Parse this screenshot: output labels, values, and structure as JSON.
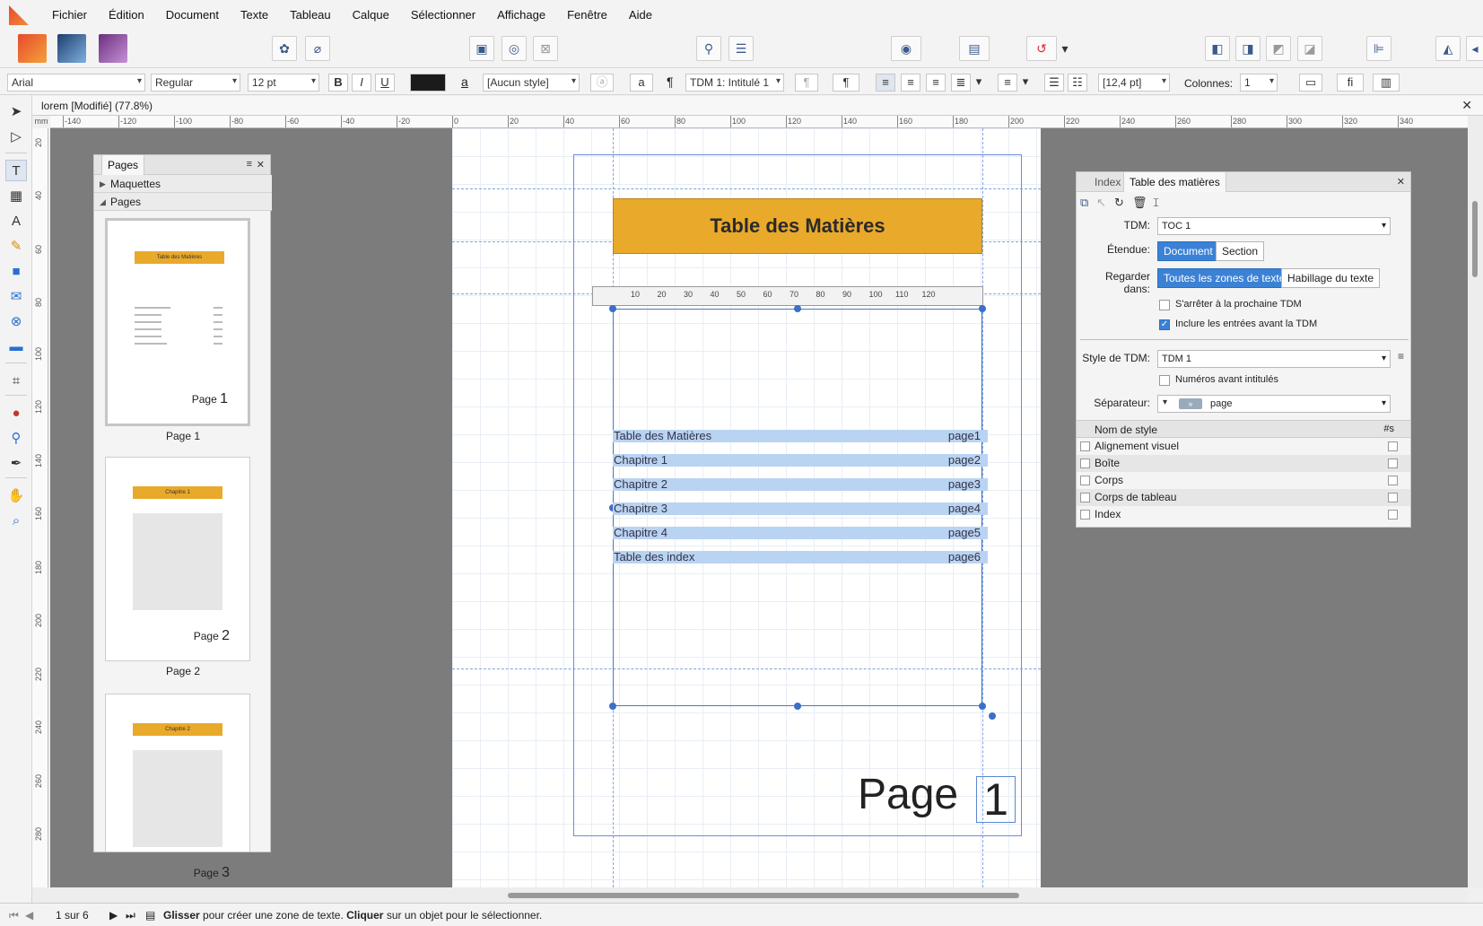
{
  "menu": [
    "Fichier",
    "Édition",
    "Document",
    "Texte",
    "Tableau",
    "Calque",
    "Sélectionner",
    "Affichage",
    "Fenêtre",
    "Aide"
  ],
  "context_toolbar": {
    "font": "Arial",
    "weight": "Regular",
    "size": "12 pt",
    "bold": "B",
    "italic": "I",
    "underline": "U",
    "char_style": "[Aucun style]",
    "para_style": "TDM 1: Intitulé 1",
    "leading": "[12,4 pt]",
    "columns_label": "Colonnes:",
    "columns_value": "1",
    "glyph_a": "a",
    "pilcrow": "¶",
    "ligature": "fi"
  },
  "document_tab": {
    "title": "lorem [Modifié] (77.8%)"
  },
  "ruler": {
    "unit": "mm",
    "top_ticks": [
      "-140",
      "-120",
      "-100",
      "-80",
      "-60",
      "-40",
      "-20",
      "0",
      "20",
      "40",
      "60",
      "80",
      "100",
      "120",
      "140",
      "160",
      "180",
      "200",
      "220",
      "240",
      "260",
      "280",
      "300",
      "320",
      "340"
    ],
    "left_ticks": [
      "20",
      "40",
      "60",
      "80",
      "100",
      "120",
      "140",
      "160",
      "180",
      "200",
      "220",
      "240",
      "260",
      "280"
    ],
    "text_ruler_ticks": [
      "10",
      "20",
      "30",
      "40",
      "50",
      "60",
      "70",
      "80",
      "90",
      "100",
      "110",
      "120"
    ]
  },
  "pages_panel": {
    "tab": "Pages",
    "section_masters": "Maquettes",
    "section_pages": "Pages",
    "thumbs": [
      {
        "label": "Page 1",
        "mini_title": "Table des Matières",
        "mini_page_word": "Page",
        "mini_page_num": "1"
      },
      {
        "label": "Page 2",
        "mini_title": "Chapitre 1",
        "mini_page_word": "Page",
        "mini_page_num": "2"
      },
      {
        "label": "",
        "mini_title": "Chapitre 2",
        "mini_page_word": "Page",
        "mini_page_num": "3"
      }
    ]
  },
  "document": {
    "title": "Table des Matières",
    "toc": [
      {
        "title": "Table des Matières",
        "page": "page1"
      },
      {
        "title": "Chapitre 1",
        "page": "page2"
      },
      {
        "title": "Chapitre 2",
        "page": "page3"
      },
      {
        "title": "Chapitre 3",
        "page": "page4"
      },
      {
        "title": "Chapitre 4",
        "page": "page5"
      },
      {
        "title": "Table des index",
        "page": "page6"
      }
    ],
    "page_word": "Page",
    "page_num": "1"
  },
  "toc_panel": {
    "tabs": [
      "Index",
      "Table des matières"
    ],
    "tdm_label": "TDM:",
    "tdm_value": "TOC 1",
    "scope_label": "Étendue:",
    "scope_options": [
      "Document",
      "Section"
    ],
    "look_label": "Regarder dans:",
    "look_options": [
      "Toutes les zones de texte",
      "Habillage du texte"
    ],
    "stop_next": "S'arrêter à la prochaine TDM",
    "include_before": "Inclure les entrées avant la TDM",
    "style_label": "Style de TDM:",
    "style_value": "TDM 1",
    "numbers_before": "Numéros avant intitulés",
    "separator_label": "Séparateur:",
    "separator_value": "page",
    "col_name": "Nom de style",
    "col_s": "#s",
    "styles": [
      "Alignement visuel",
      "Boîte",
      "Corps",
      "Corps de tableau",
      "Index"
    ]
  },
  "status": {
    "page_count": "1 sur 6",
    "hint_bold1": "Glisser",
    "hint_text1": " pour créer une zone de texte. ",
    "hint_bold2": "Cliquer",
    "hint_text2": " sur un objet pour le sélectionner."
  }
}
